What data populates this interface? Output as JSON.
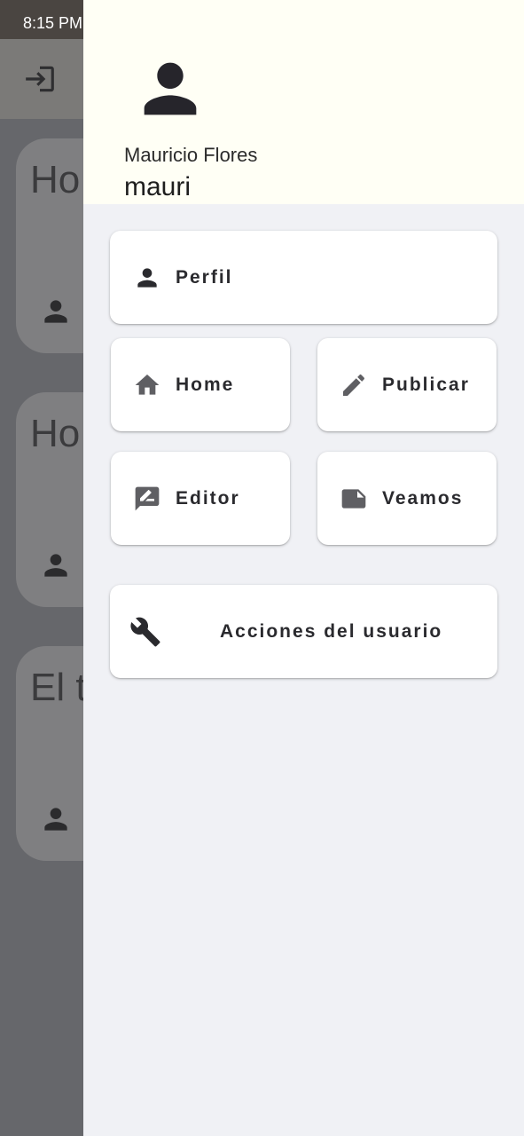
{
  "status_bar": {
    "time": "8:15 PM"
  },
  "background": {
    "cards": [
      {
        "title": "Ho"
      },
      {
        "title": "Ho"
      },
      {
        "title": "El t"
      }
    ]
  },
  "drawer": {
    "user": {
      "full_name": "Mauricio Flores",
      "username": "mauri"
    },
    "items": {
      "perfil": {
        "label": "Perfil",
        "icon": "person-icon"
      },
      "home": {
        "label": "Home",
        "icon": "home-icon"
      },
      "publicar": {
        "label": "Publicar",
        "icon": "pencil-icon"
      },
      "editor": {
        "label": "Editor",
        "icon": "rate-review-icon"
      },
      "veamos": {
        "label": "Veamos",
        "icon": "note-icon"
      },
      "acciones": {
        "label": "Acciones del usuario",
        "icon": "wrench-icon"
      }
    }
  },
  "colors": {
    "drawer_bg": "#f0f1f5",
    "header_bg": "#fffff5",
    "scrim": "#66676b",
    "icon_grey": "#5f5f63"
  }
}
